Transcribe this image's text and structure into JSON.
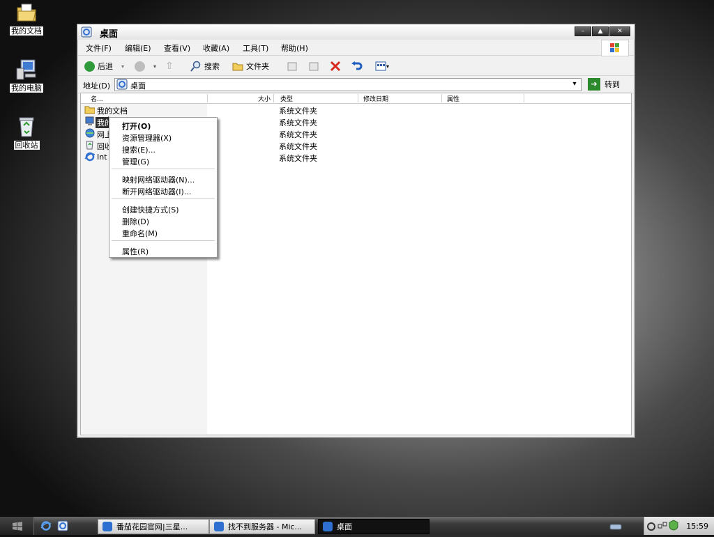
{
  "desktop": {
    "icons": [
      {
        "label": "我的文档",
        "icon": "my-documents-icon"
      },
      {
        "label": "我的电脑",
        "icon": "my-computer-icon"
      },
      {
        "label": "回收站",
        "icon": "recycle-bin-icon"
      }
    ]
  },
  "window": {
    "title": "桌面",
    "controls": {
      "minimize": "–",
      "maximize": "▲",
      "close": "✕"
    },
    "menu": [
      "文件(F)",
      "编辑(E)",
      "查看(V)",
      "收藏(A)",
      "工具(T)",
      "帮助(H)"
    ],
    "toolbar": {
      "back": "后退",
      "search": "搜索",
      "folders": "文件夹"
    },
    "address": {
      "label": "地址(D)",
      "value": "桌面",
      "go": "转到"
    },
    "columns": [
      "名...",
      "大小",
      "类型",
      "修改日期",
      "属性"
    ],
    "rows": [
      {
        "name": "我的文档",
        "type": "系统文件夹"
      },
      {
        "name": "我的",
        "type": "系统文件夹"
      },
      {
        "name": "网上",
        "type": "系统文件夹"
      },
      {
        "name": "回收",
        "type": "系统文件夹"
      },
      {
        "name": "Int",
        "type": "系统文件夹"
      }
    ]
  },
  "context_menu": {
    "items": [
      "打开(O)",
      "资源管理器(X)",
      "搜索(E)...",
      "管理(G)",
      "映射网络驱动器(N)...",
      "断开网络驱动器(I)...",
      "创建快捷方式(S)",
      "删除(D)",
      "重命名(M)",
      "属性(R)"
    ]
  },
  "taskbar": {
    "tasks": [
      "番茄花园官网|三星...",
      "找不到服务器 - Mic...",
      "桌面"
    ],
    "clock": "15:59"
  }
}
